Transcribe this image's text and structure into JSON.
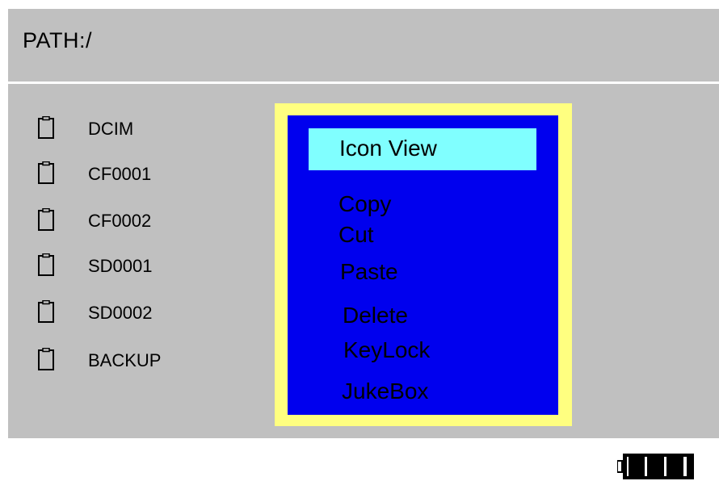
{
  "path": {
    "label": "PATH:/"
  },
  "files": [
    {
      "name": "DCIM",
      "icon": "folder-icon"
    },
    {
      "name": "CF0001",
      "icon": "folder-icon"
    },
    {
      "name": "CF0002",
      "icon": "folder-icon"
    },
    {
      "name": "SD0001",
      "icon": "folder-icon"
    },
    {
      "name": "SD0002",
      "icon": "folder-icon"
    },
    {
      "name": "BACKUP",
      "icon": "folder-icon"
    }
  ],
  "context_menu": {
    "items": [
      "Icon View",
      "Copy",
      "Cut",
      "Paste",
      "Delete",
      "KeyLock",
      "JukeBox"
    ],
    "selected": "Icon View"
  },
  "battery": {
    "icon": "battery-icon",
    "level": 1.0
  },
  "colors": {
    "screen_background": "#c0c0c0",
    "menu_border": "#ffff80",
    "menu_background": "#0000ee",
    "menu_selected_background": "#80ffff"
  }
}
